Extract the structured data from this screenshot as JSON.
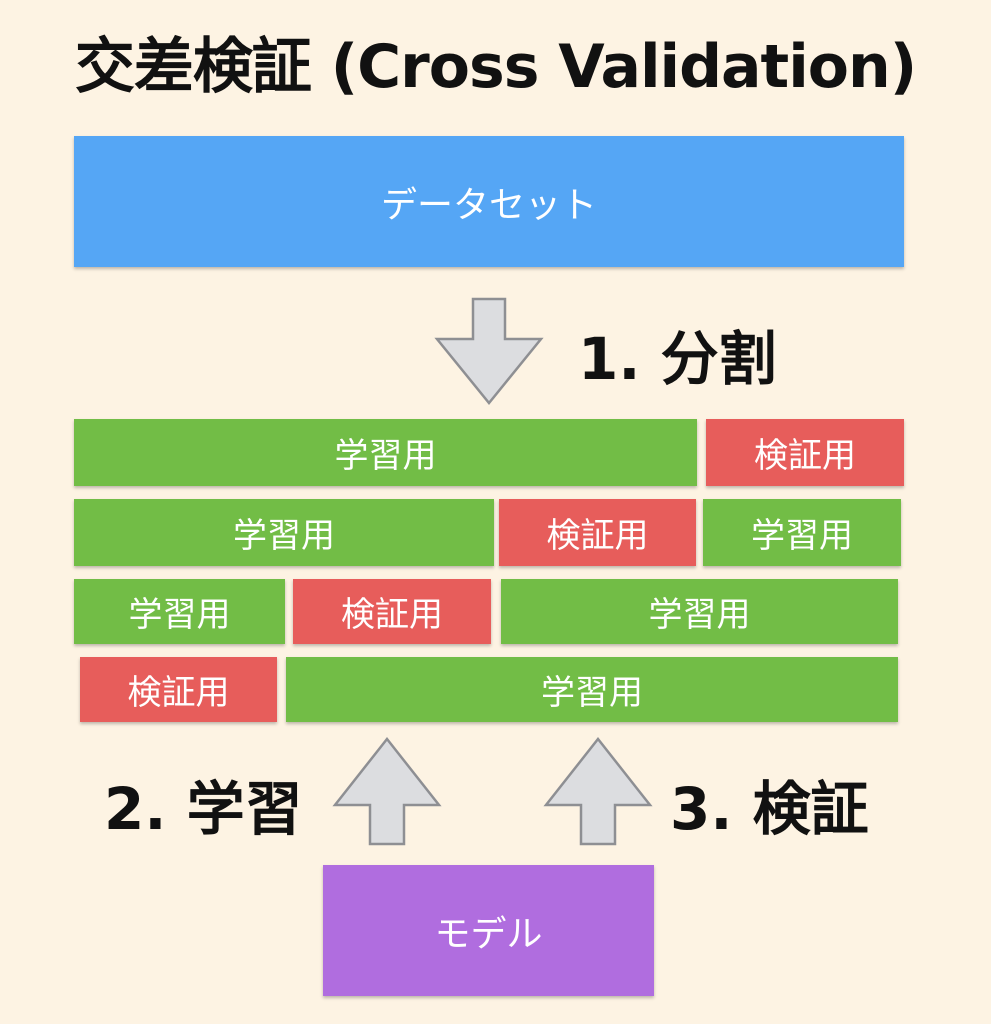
{
  "title": "交差検証 (Cross Validation)",
  "dataset": {
    "label": "データセット",
    "color": "#55a6f5"
  },
  "model": {
    "label": "モデル",
    "color": "#b06ddf"
  },
  "steps": {
    "split": "1. 分割",
    "train": "2. 学習",
    "validate": "3. 検証"
  },
  "colors": {
    "train": "#72bd46",
    "validation": "#e75d5b",
    "arrow_fill": "#dcdde0",
    "arrow_stroke": "#8e8f93"
  },
  "folds": [
    {
      "segments": [
        {
          "kind": "train",
          "label": "学習用"
        },
        {
          "kind": "validation",
          "label": "検証用"
        }
      ]
    },
    {
      "segments": [
        {
          "kind": "train",
          "label": "学習用"
        },
        {
          "kind": "validation",
          "label": "検証用"
        },
        {
          "kind": "train",
          "label": "学習用"
        }
      ]
    },
    {
      "segments": [
        {
          "kind": "train",
          "label": "学習用"
        },
        {
          "kind": "validation",
          "label": "検証用"
        },
        {
          "kind": "train",
          "label": "学習用"
        }
      ]
    },
    {
      "segments": [
        {
          "kind": "validation",
          "label": "検証用"
        },
        {
          "kind": "train",
          "label": "学習用"
        }
      ]
    }
  ]
}
